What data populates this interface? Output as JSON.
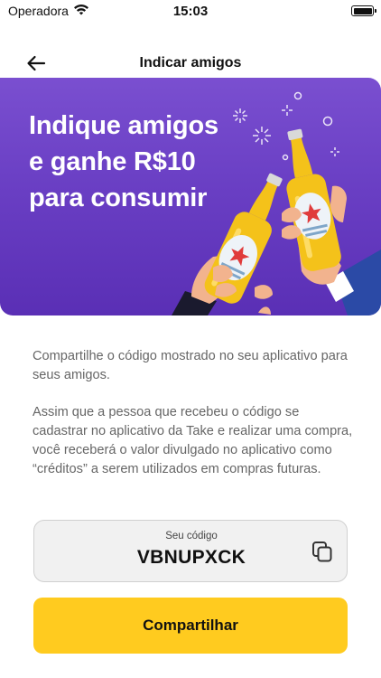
{
  "status_bar": {
    "carrier": "Operadora",
    "time": "15:03",
    "icons": [
      "wifi-icon",
      "battery-icon"
    ]
  },
  "nav": {
    "title": "Indicar amigos",
    "back_icon": "arrow-left-icon"
  },
  "banner": {
    "title_lines": [
      "Indique amigos",
      "e ganhe R$10",
      "para consumir"
    ],
    "illustration": "two-beer-bottles-toast",
    "colors": {
      "background": "#6a3fc4",
      "beer": "#f4c21a",
      "label_star": "#e03b3b"
    }
  },
  "description": {
    "paragraph_1": "Compartilhe o código mostrado no seu aplicativo para seus amigos.",
    "paragraph_2": "Assim que a pessoa que recebeu o código se cadastrar no aplicativo da Take e realizar uma compra, você receberá o valor divulgado no aplicativo como “créditos” a serem utilizados em compras futuras."
  },
  "code": {
    "label": "Seu código",
    "value": "VBNUPXCK",
    "copy_icon": "copy-icon"
  },
  "share": {
    "label": "Compartilhar",
    "color": "#ffcb1f"
  }
}
